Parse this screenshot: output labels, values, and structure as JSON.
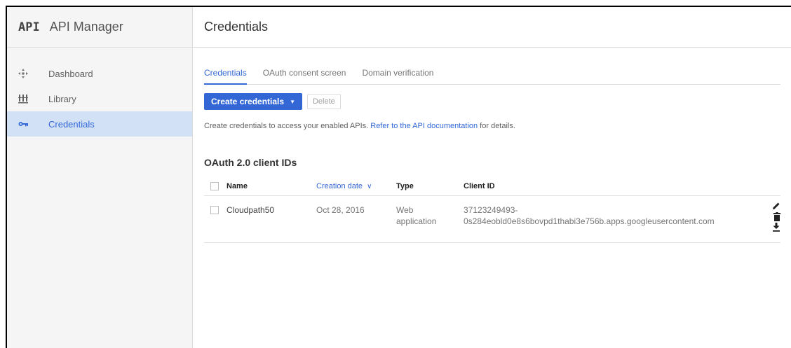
{
  "sidebar": {
    "logo": "API",
    "title": "API Manager",
    "items": [
      {
        "label": "Dashboard",
        "icon": "dashboard-icon"
      },
      {
        "label": "Library",
        "icon": "library-icon"
      },
      {
        "label": "Credentials",
        "icon": "key-icon",
        "active": true
      }
    ]
  },
  "header": {
    "title": "Credentials"
  },
  "tabs": [
    {
      "label": "Credentials",
      "active": true
    },
    {
      "label": "OAuth consent screen"
    },
    {
      "label": "Domain verification"
    }
  ],
  "toolbar": {
    "create_label": "Create credentials",
    "delete_label": "Delete"
  },
  "info": {
    "text": "Create credentials to access your enabled APIs. ",
    "link": "Refer to the API documentation",
    "suffix": " for details."
  },
  "section": {
    "title": "OAuth 2.0 client IDs"
  },
  "table": {
    "columns": [
      "Name",
      "Creation date",
      "Type",
      "Client ID"
    ],
    "sort_indicator": "∨",
    "rows": [
      {
        "name": "Cloudpath50",
        "date": "Oct 28, 2016",
        "type_line1": "Web",
        "type_line2": "application",
        "client_id_line1": "37123249493-",
        "client_id_line2": "0s284eobld0e8s6bovpd1thabi3e756b.apps.googleusercontent.com"
      }
    ]
  },
  "colors": {
    "accent": "#3367d6",
    "active_bg": "#d3e1f7",
    "sidebar_bg": "#f5f5f5"
  }
}
